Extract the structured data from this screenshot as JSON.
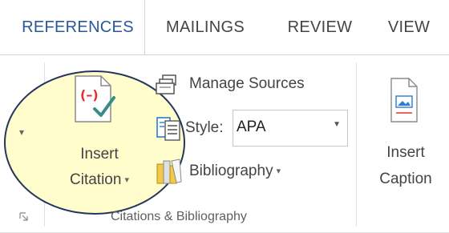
{
  "tabs": [
    {
      "label": "REFERENCES",
      "active": true
    },
    {
      "label": "MAILINGS",
      "active": false
    },
    {
      "label": "REVIEW",
      "active": false
    },
    {
      "label": "VIEW",
      "active": false
    }
  ],
  "left_dropdown_glyph": "▾",
  "insert_citation": {
    "line1": "Insert",
    "line2": "Citation",
    "icon": "insert-citation-icon"
  },
  "manage_sources": {
    "label": "Manage Sources",
    "icon": "manage-sources-icon"
  },
  "style": {
    "label": "Style:",
    "value": "APA",
    "icon": "style-icon"
  },
  "bibliography": {
    "label": "Bibliography",
    "icon": "bibliography-icon"
  },
  "group_label": "Citations & Bibliography",
  "insert_caption": {
    "line1": "Insert",
    "line2": "Caption",
    "icon": "insert-caption-icon"
  },
  "colors": {
    "accent": "#2b579a",
    "highlight": "#fffdc8",
    "highlight_border": "#24365e",
    "citation_red": "#e0322d",
    "check_teal": "#3a8c8a"
  }
}
